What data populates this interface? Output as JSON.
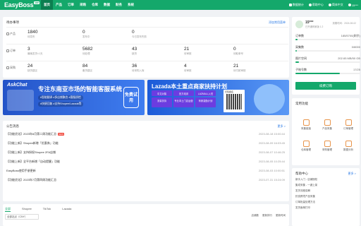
{
  "header": {
    "logo": "EasyBoss",
    "logo_tag": "ERP",
    "nav": [
      "首页",
      "产品",
      "订单",
      "采购",
      "仓库",
      "数据",
      "财务",
      "系统"
    ],
    "right": [
      "数据统计",
      "帮助中心",
      "简体中文",
      "15***"
    ]
  },
  "todo": {
    "title": "待办事项",
    "more": "添加常用菜单",
    "rows": [
      {
        "label": "产品",
        "cells": [
          {
            "v": "1840",
            "l": "待发布"
          },
          {
            "v": "0",
            "l": "发布中"
          },
          {
            "v": "0",
            "l": "今日发布失败"
          }
        ]
      },
      {
        "label": "订单",
        "cells": [
          {
            "v": "3",
            "l": "最晚发货<1天"
          },
          {
            "v": "5682",
            "l": "待处理"
          },
          {
            "v": "43",
            "l": "缺货"
          },
          {
            "v": "21",
            "l": "待审核"
          },
          {
            "v": "0",
            "l": "待取单号"
          }
        ]
      },
      {
        "label": "采购",
        "cells": [
          {
            "v": "24",
            "l": "缺货建议"
          },
          {
            "v": "84",
            "l": "备货建议"
          },
          {
            "v": "36",
            "l": "待采购入库"
          },
          {
            "v": "4",
            "l": "待审核"
          },
          {
            "v": "21",
            "l": "待付款审核"
          }
        ]
      }
    ]
  },
  "banner1": {
    "brand": "AskChat",
    "title": "专注东南亚市场的智能客服系统",
    "sub": "#智能翻译  #多店铺聚合  #客服质检",
    "sub2": "#快捷回复 #支持Shopee/Lazada等",
    "badge": "免费试用"
  },
  "banner2": {
    "title": "Lazada本土重点商家扶持计划",
    "tags": [
      "中文对接",
      "官方培训",
      "LAZMALL入驻",
      "流量扶持",
      "专业本土门店运营",
      "商家激励计划"
    ],
    "qr": "扫码报名"
  },
  "announce": {
    "title": "公告消息",
    "more": "更多 >",
    "items": [
      {
        "t": "【功能优化】2023年8月第二周功能汇总",
        "d": "2023-08-18 15:00:44",
        "hot": "NEW"
      },
      {
        "t": "【功能上新】Shopee新增「优惠券」功能",
        "d": "2023-08-09 16:03:45"
      },
      {
        "t": "【功能上新】支持授权Shopee 2FA店铺",
        "d": "2023-08-07 10:46:25"
      },
      {
        "t": "【功能上新】全平台新增「自动提醒」功能",
        "d": "2023-08-05 10:25:44"
      },
      {
        "t": "EasyBoss使用手册更新",
        "d": "2023-08-03 10:00:51"
      },
      {
        "t": "【功能优化】2023年7月第四周功能汇总",
        "d": "2023-07-31 15:24:09"
      }
    ]
  },
  "bottom": {
    "tabs": [
      "全部",
      "Shopee",
      "TikTok",
      "Lazada"
    ],
    "select": "全部站点（CNY）",
    "actions": [
      "店铺数",
      "更新排行",
      "更新时间"
    ]
  },
  "account": {
    "name": "15***",
    "plan": "已开通商家版 1.2",
    "expire": "到期时间：2024-08-02",
    "stats": [
      {
        "k": "订单数",
        "v": "185/5700(剩余)",
        "p": 0.03
      },
      {
        "k": "采集数",
        "v": "0/8000",
        "p": 0.0
      },
      {
        "k": "图片空间",
        "v": "202.65 MB/50 GB",
        "p": 0.05
      },
      {
        "k": "子账号数",
        "v": "17/25",
        "p": 0.68
      }
    ],
    "btn": "续费订购"
  },
  "quick": {
    "title": "常用功能",
    "items": [
      "采集链接",
      "产品采集",
      "订单管理",
      "仓库管理",
      "采购管理",
      "数据分析"
    ]
  },
  "help": {
    "title": "帮助中心",
    "more": "更多 >",
    "items": [
      "新手入门 - 店铺授权",
      "集成采集 - 一键上架",
      "发货流程讲解",
      "虾皮跨境产品采集",
      "订单批量处理方法",
      "发货面单打印"
    ]
  },
  "colors": {
    "brand": "#14a86b"
  }
}
